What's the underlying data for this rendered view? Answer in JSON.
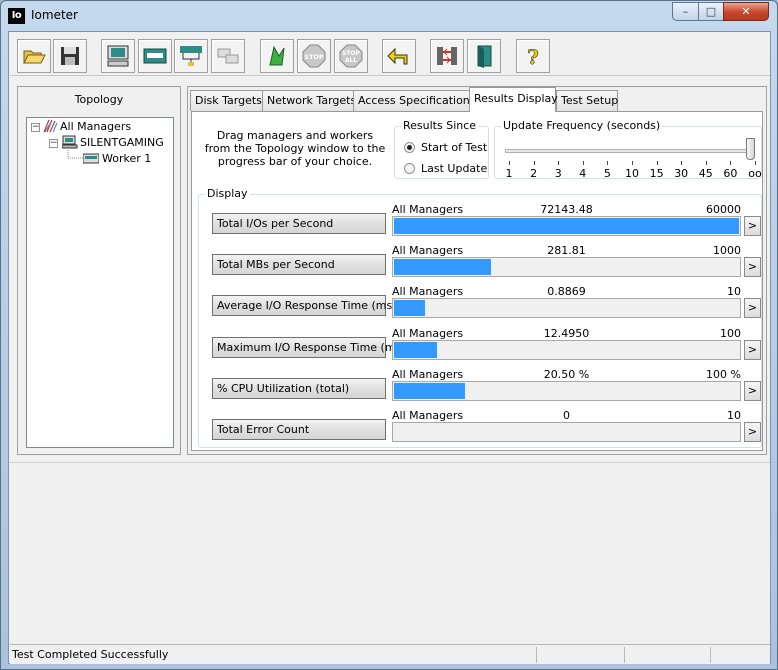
{
  "window": {
    "title": "Iometer",
    "app_icon_text": "Io"
  },
  "toolbar": {
    "buttons": [
      {
        "name": "open-config-icon"
      },
      {
        "name": "save-config-icon"
      },
      {
        "name": "new-disk-worker-icon"
      },
      {
        "name": "new-network-worker-icon"
      },
      {
        "name": "duplicate-worker-icon"
      },
      {
        "name": "disconnect-manager-icon"
      },
      {
        "name": "start-tests-icon"
      },
      {
        "name": "stop-test-icon"
      },
      {
        "name": "stop-all-icon"
      },
      {
        "name": "reset-workers-icon"
      },
      {
        "name": "connect-manager-icon"
      },
      {
        "name": "exit-icon"
      },
      {
        "name": "about-icon"
      }
    ],
    "stop_label": "STOP",
    "stop_all_top": "STOP",
    "stop_all_bottom": "ALL",
    "about_glyph": "?"
  },
  "topology": {
    "label": "Topology",
    "root": "All Managers",
    "manager": "SILENTGAMING",
    "worker": "Worker 1",
    "expander_glyph": "−"
  },
  "tabs": [
    {
      "label": "Disk Targets"
    },
    {
      "label": "Network Targets"
    },
    {
      "label": "Access Specifications"
    },
    {
      "label": "Results Display",
      "active": true
    },
    {
      "label": "Test Setup"
    }
  ],
  "results": {
    "drag_text": "Drag managers and workers from the Topology window to the progress bar of your choice.",
    "since": {
      "title": "Results Since",
      "start": "Start of Test",
      "last": "Last Update",
      "selected": "start"
    },
    "frequency": {
      "title": "Update Frequency (seconds)",
      "ticks": [
        "1",
        "2",
        "3",
        "4",
        "5",
        "10",
        "15",
        "30",
        "45",
        "60",
        "oo"
      ],
      "selected_index": 10
    },
    "display_title": "Display",
    "arrow_glyph": ">",
    "metrics": [
      {
        "button": "Total I/Os per Second",
        "source": "All Managers",
        "value": "72143.48",
        "max": "60000",
        "fill": 1.0
      },
      {
        "button": "Total MBs per Second",
        "source": "All Managers",
        "value": "281.81",
        "max": "1000",
        "fill": 0.2818
      },
      {
        "button": "Average I/O Response Time (ms)",
        "source": "All Managers",
        "value": "0.8869",
        "max": "10",
        "fill": 0.0887
      },
      {
        "button": "Maximum I/O Response Time (ms)",
        "source": "All Managers",
        "value": "12.4950",
        "max": "100",
        "fill": 0.125
      },
      {
        "button": "% CPU Utilization (total)",
        "source": "All Managers",
        "value": "20.50 %",
        "max": "100 %",
        "fill": 0.205
      },
      {
        "button": "Total Error Count",
        "source": "All Managers",
        "value": "0",
        "max": "10",
        "fill": 0.0
      }
    ]
  },
  "status": {
    "text": "Test Completed Successfully"
  },
  "colors": {
    "bar_fill": "#3399ff",
    "close_button": "#c7452a"
  }
}
